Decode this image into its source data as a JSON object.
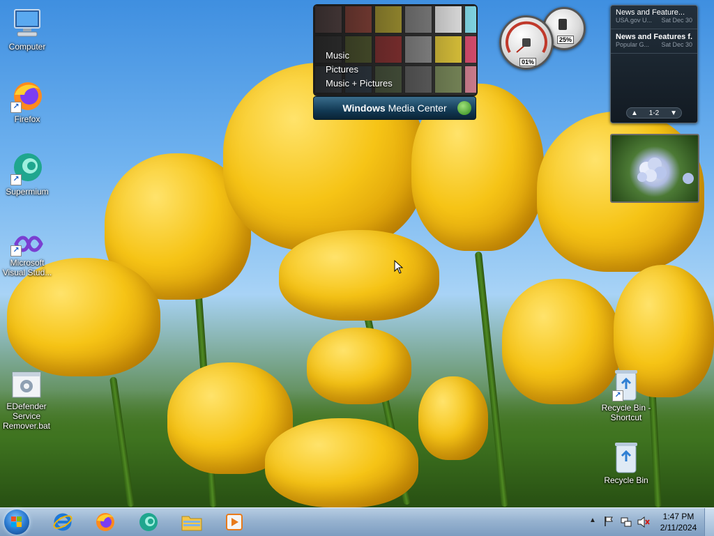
{
  "desktop_icons": {
    "computer": "Computer",
    "firefox": "Firefox",
    "supermium": "Supermium",
    "vs_line1": "Microsoft",
    "vs_line2": "Visual Stud...",
    "edefender_line1": "EDefender",
    "edefender_line2": "Service",
    "edefender_line3": "Remover.bat",
    "recycle_shortcut_line1": "Recycle Bin -",
    "recycle_shortcut_line2": "Shortcut",
    "recycle_bin": "Recycle Bin"
  },
  "media_center": {
    "menu": [
      "Music",
      "Pictures",
      "Music + Pictures"
    ],
    "title_bold": "Windows",
    "title_rest": " Media Center"
  },
  "meters": {
    "cpu": "01%",
    "memory": "25%"
  },
  "feed": {
    "items": [
      {
        "title": "News and Feature...",
        "source": "USA.gov U...",
        "date": "Sat Dec 30"
      },
      {
        "title": "News and Features f...",
        "source": "Popular G...",
        "date": "Sat Dec 30"
      }
    ],
    "page": "1-2"
  },
  "taskbar": {
    "time": "1:47 PM",
    "date": "2/11/2024"
  },
  "colors": {
    "taskbar_top": "#b7cde3",
    "accent_blue": "#2a79cf",
    "tulip_yellow": "#f6c416"
  }
}
